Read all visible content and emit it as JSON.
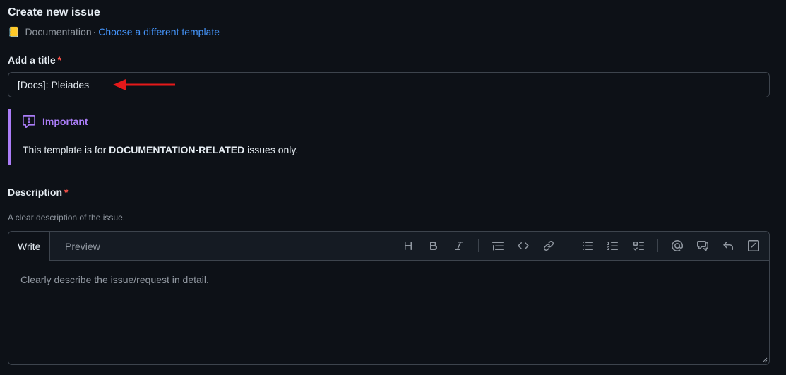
{
  "header": {
    "title": "Create new issue",
    "template_icon": "notebook-icon",
    "template_name": "Documentation",
    "separator": "·",
    "change_template_link": "Choose a different template"
  },
  "title_field": {
    "label": "Add a title",
    "required_mark": "*",
    "value": "[Docs]: Pleiades"
  },
  "callout": {
    "icon": "report-icon",
    "heading": "Important",
    "text_before": "This template is for ",
    "text_bold": "DOCUMENTATION-RELATED",
    "text_after": " issues only.",
    "accent_color": "#ab7df8"
  },
  "description_field": {
    "label": "Description",
    "required_mark": "*",
    "hint": "A clear description of the issue.",
    "placeholder": "Clearly describe the issue/request in detail."
  },
  "editor": {
    "tabs": [
      {
        "label": "Write",
        "active": true
      },
      {
        "label": "Preview",
        "active": false
      }
    ],
    "toolbar": [
      "heading-icon",
      "bold-icon",
      "italic-icon",
      "quote-icon",
      "code-icon",
      "link-icon",
      "unordered-list-icon",
      "ordered-list-icon",
      "task-list-icon",
      "mention-icon",
      "cross-reference-icon",
      "reply-icon",
      "slash-commands-icon"
    ]
  },
  "colors": {
    "background": "#0d1117",
    "link": "#4493f8",
    "required": "#f85149",
    "annotation_arrow": "#e5191a"
  }
}
